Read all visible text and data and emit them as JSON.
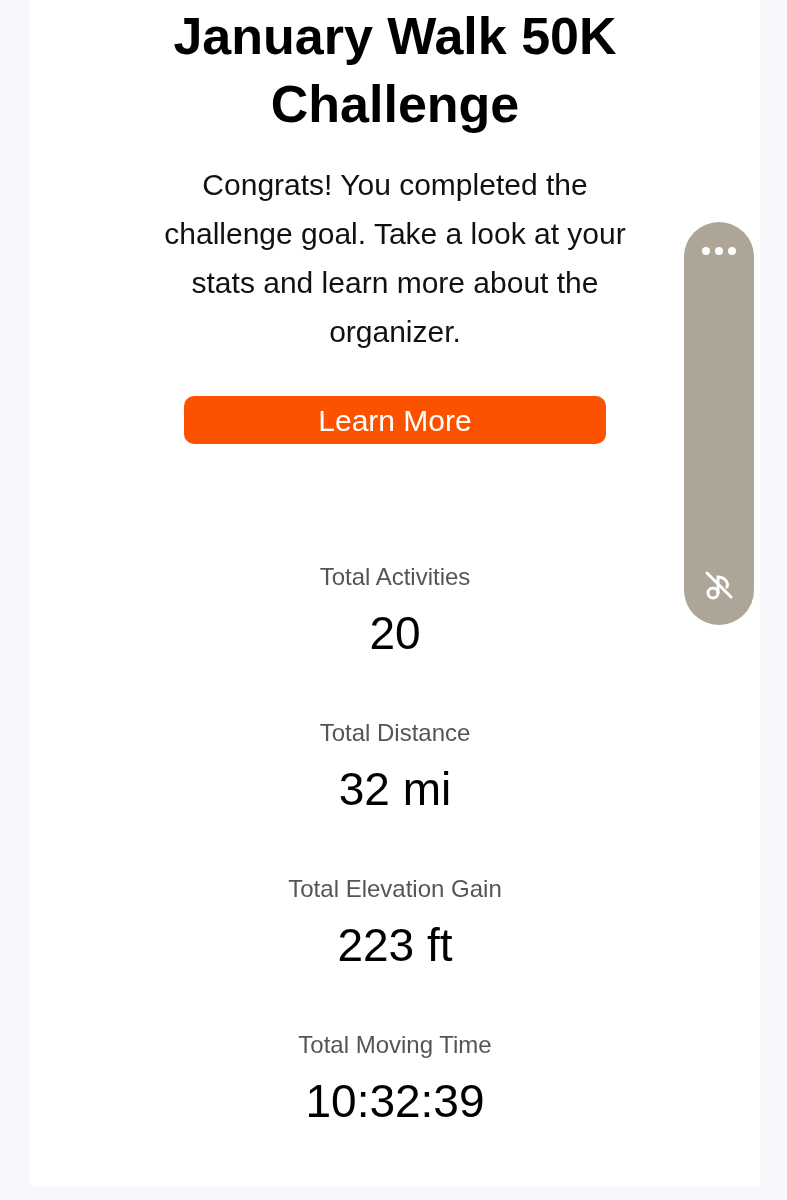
{
  "title": "January Walk 50K Challenge",
  "message": "Congrats! You completed the challenge goal. Take a look at your stats and learn more about the organizer.",
  "button": "Learn More",
  "stats": [
    {
      "label": "Total Activities",
      "value": "20"
    },
    {
      "label": "Total Distance",
      "value": "32 mi"
    },
    {
      "label": "Total Elevation Gain",
      "value": "223 ft"
    },
    {
      "label": "Total Moving Time",
      "value": "10:32:39"
    }
  ]
}
